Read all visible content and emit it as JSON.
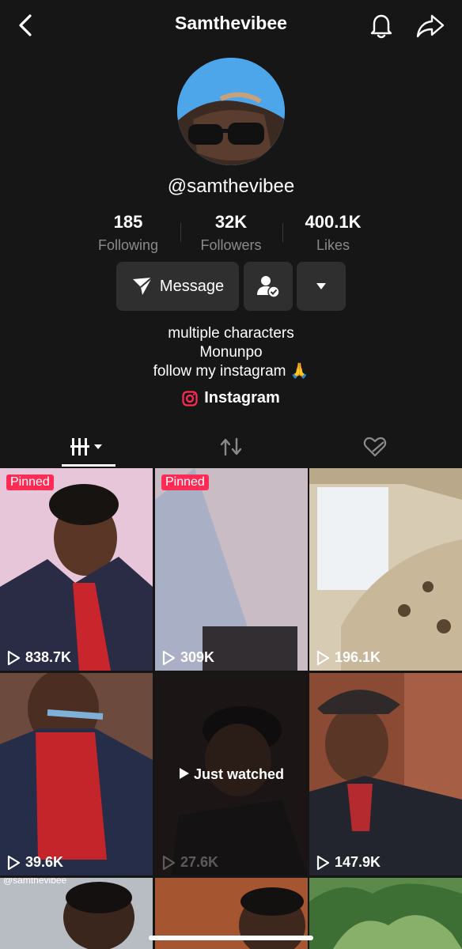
{
  "header": {
    "title": "Samthevibee",
    "icons": [
      "back-chevron-icon",
      "bell-icon",
      "share-icon"
    ]
  },
  "profile": {
    "handle": "@samthevibee",
    "stats": [
      {
        "value": "185",
        "label": "Following"
      },
      {
        "value": "32K",
        "label": "Followers"
      },
      {
        "value": "400.1K",
        "label": "Likes"
      }
    ],
    "message_label": "Message",
    "bio": [
      "multiple characters",
      "Monunpo",
      "follow my instagram 🙏"
    ],
    "instagram_label": "Instagram"
  },
  "colors": {
    "background": "#161616",
    "pinned_badge": "#fe2c55",
    "button_bg": "#2f2f2f"
  },
  "videos": [
    {
      "views": "838.7K",
      "pinned": "Pinned"
    },
    {
      "views": "309K",
      "pinned": "Pinned"
    },
    {
      "views": "196.1K"
    },
    {
      "views": "39.6K"
    },
    {
      "views": "27.6K",
      "status": "Just watched"
    },
    {
      "views": "147.9K"
    },
    {
      "watermark": "@samthevibee"
    },
    {},
    {}
  ]
}
